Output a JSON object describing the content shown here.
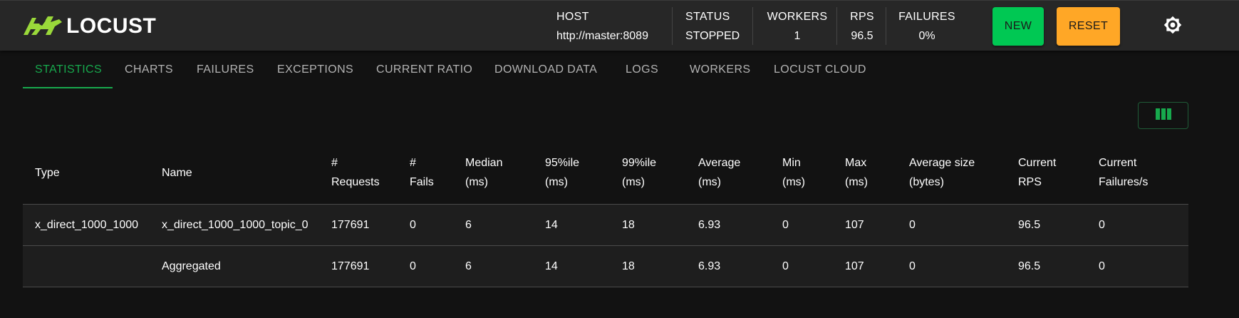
{
  "app": {
    "logo_text": "LOCUST",
    "logo_icon": "locust-grasshopper-icon"
  },
  "header": {
    "host": {
      "label": "HOST",
      "value": "http://master:8089"
    },
    "status": {
      "label": "STATUS",
      "value": "STOPPED"
    },
    "workers": {
      "label": "WORKERS",
      "value": "1"
    },
    "rps": {
      "label": "RPS",
      "value": "96.5"
    },
    "failures": {
      "label": "FAILURES",
      "value": "0%"
    },
    "new_label": "NEW",
    "reset_label": "RESET",
    "theme_icon": "brightness-icon"
  },
  "tabs": [
    {
      "label": "STATISTICS",
      "active": true
    },
    {
      "label": "CHARTS"
    },
    {
      "label": "FAILURES"
    },
    {
      "label": "EXCEPTIONS"
    },
    {
      "label": "CURRENT RATIO"
    },
    {
      "label": "DOWNLOAD DATA"
    },
    {
      "label": "LOGS"
    },
    {
      "label": "WORKERS"
    },
    {
      "label": "LOCUST CLOUD"
    }
  ],
  "table": {
    "columns": [
      {
        "line1": "Type",
        "line2": ""
      },
      {
        "line1": "Name",
        "line2": ""
      },
      {
        "line1": "#",
        "line2": "Requests"
      },
      {
        "line1": "#",
        "line2": "Fails"
      },
      {
        "line1": "Median",
        "line2": "(ms)"
      },
      {
        "line1": "95%ile",
        "line2": "(ms)"
      },
      {
        "line1": "99%ile",
        "line2": "(ms)"
      },
      {
        "line1": "Average",
        "line2": "(ms)"
      },
      {
        "line1": "Min",
        "line2": "(ms)"
      },
      {
        "line1": "Max",
        "line2": "(ms)"
      },
      {
        "line1": "Average size",
        "line2": "(bytes)"
      },
      {
        "line1": "Current",
        "line2": "RPS"
      },
      {
        "line1": "Current",
        "line2": "Failures/s"
      }
    ],
    "rows": [
      [
        "x_direct_1000_1000",
        "x_direct_1000_1000_topic_0",
        "177691",
        "0",
        "6",
        "14",
        "18",
        "6.93",
        "0",
        "107",
        "0",
        "96.5",
        "0"
      ],
      [
        "",
        "Aggregated",
        "177691",
        "0",
        "6",
        "14",
        "18",
        "6.93",
        "0",
        "107",
        "0",
        "96.5",
        "0"
      ]
    ]
  },
  "colors": {
    "accent_green": "#17a94d",
    "new_button": "#00c853",
    "reset_button": "#ffa726",
    "logo_green": "#9ad93a"
  }
}
